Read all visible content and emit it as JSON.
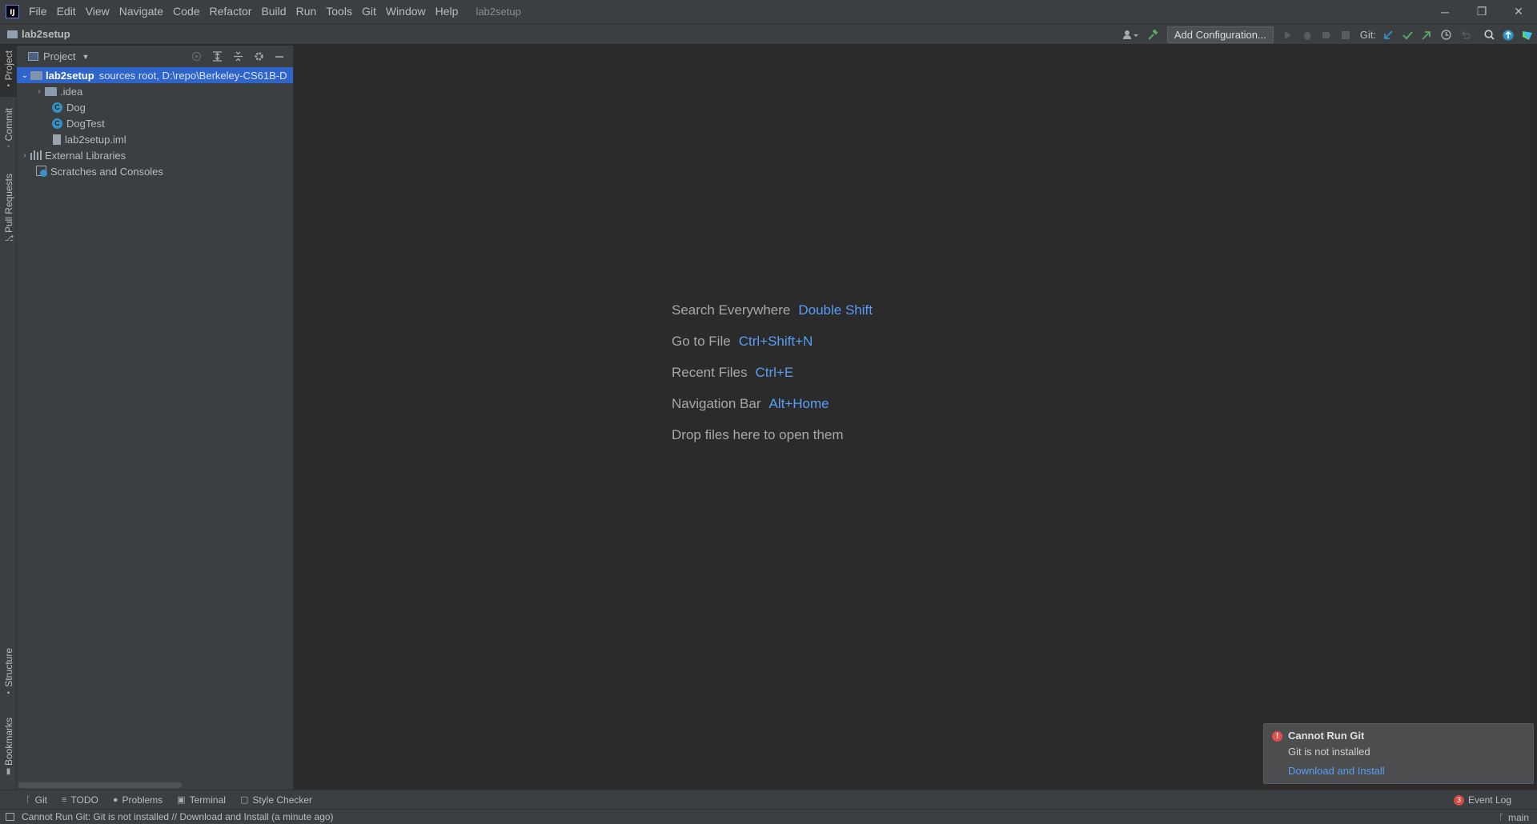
{
  "window": {
    "title": "lab2setup",
    "menu": [
      "File",
      "Edit",
      "View",
      "Navigate",
      "Code",
      "Refactor",
      "Build",
      "Run",
      "Tools",
      "Git",
      "Window",
      "Help"
    ],
    "logo_text": "IJ"
  },
  "navbar": {
    "breadcrumb": "lab2setup",
    "add_configuration": "Add Configuration...",
    "git_label": "Git:"
  },
  "left_strip": {
    "project": "Project",
    "commit": "Commit",
    "pull_requests": "Pull Requests",
    "structure": "Structure",
    "bookmarks": "Bookmarks"
  },
  "project_panel": {
    "title": "Project",
    "tree": {
      "root_name": "lab2setup",
      "root_sub": "sources root,  D:\\repo\\Berkeley-CS61B-D",
      "idea": ".idea",
      "dog": "Dog",
      "dogtest": "DogTest",
      "iml": "lab2setup.iml",
      "external_libraries": "External Libraries",
      "scratches": "Scratches and Consoles"
    }
  },
  "editor": {
    "hints": [
      {
        "label": "Search Everywhere",
        "key": "Double Shift"
      },
      {
        "label": "Go to File",
        "key": "Ctrl+Shift+N"
      },
      {
        "label": "Recent Files",
        "key": "Ctrl+E"
      },
      {
        "label": "Navigation Bar",
        "key": "Alt+Home"
      }
    ],
    "drop_hint": "Drop files here to open them"
  },
  "notification": {
    "title": "Cannot Run Git",
    "body": "Git is not installed",
    "link": "Download and Install"
  },
  "bottom_tabs": {
    "git": "Git",
    "todo": "TODO",
    "problems": "Problems",
    "terminal": "Terminal",
    "style_checker": "Style Checker",
    "event_log": "Event Log",
    "event_count": "3"
  },
  "statusbar": {
    "message": "Cannot Run Git: Git is not installed // Download and Install (a minute ago)",
    "branch": "main"
  },
  "colors": {
    "accent_link": "#589df6",
    "selection": "#2f65ca",
    "error": "#e0504d"
  }
}
